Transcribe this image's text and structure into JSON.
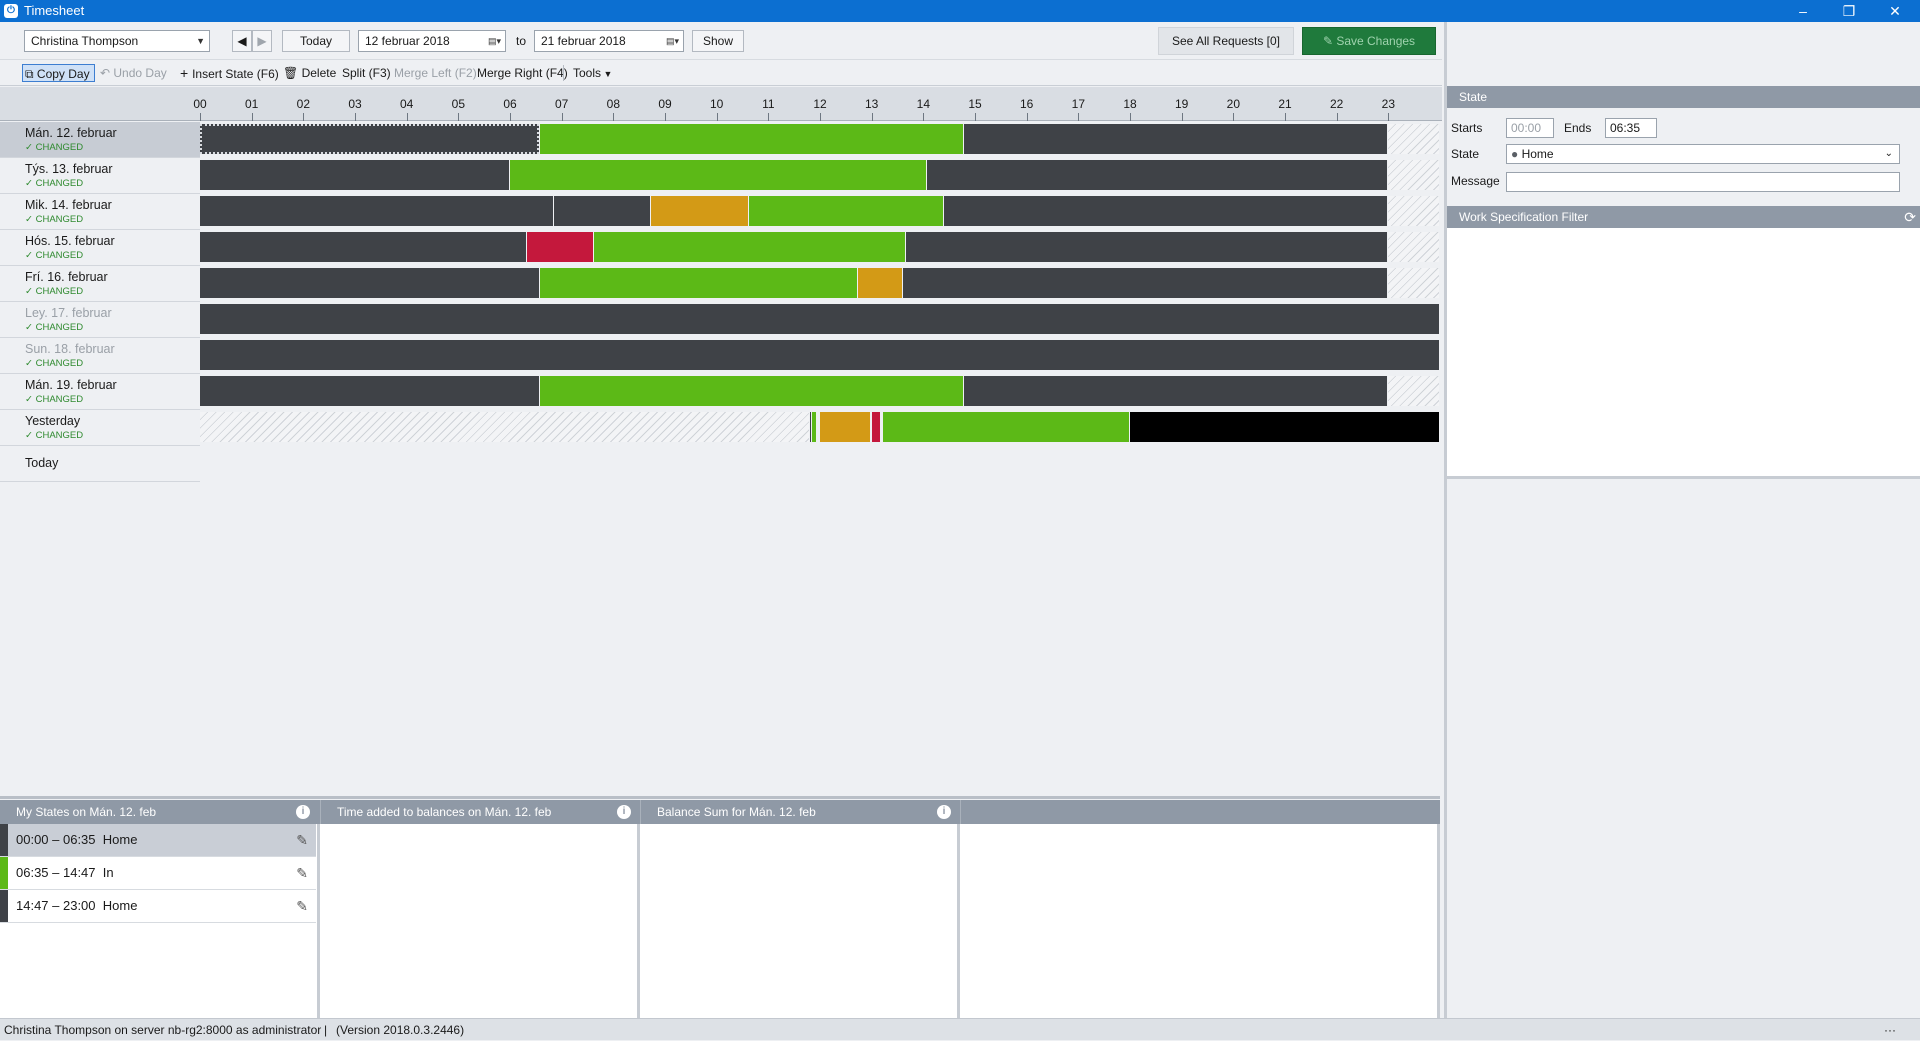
{
  "window": {
    "title": "Timesheet",
    "buttons": {
      "minimize": "–",
      "restore": "❐",
      "close": "✕"
    }
  },
  "toolbar": {
    "user": "Christina Thompson",
    "today_label": "Today",
    "from_date": "12  februar  2018",
    "to_label": "to",
    "to_date": "21  februar  2018",
    "show_label": "Show",
    "see_all_requests": "See All Requests [0]",
    "save_changes": "Save Changes"
  },
  "commands": {
    "copy_day": "Copy Day",
    "undo_day": "Undo Day",
    "insert_state": "Insert State (F6)",
    "delete": "Delete",
    "split": "Split (F3)",
    "merge_left": "Merge Left (F2)",
    "merge_right": "Merge Right (F4)",
    "tools": "Tools"
  },
  "timeline": {
    "hours": [
      "00",
      "01",
      "02",
      "03",
      "04",
      "05",
      "06",
      "07",
      "08",
      "09",
      "10",
      "11",
      "12",
      "13",
      "14",
      "15",
      "16",
      "17",
      "18",
      "19",
      "20",
      "21",
      "22",
      "23"
    ],
    "changed_label": "✓ CHANGED",
    "colors": {
      "home": "#3f4247",
      "in": "#5cb917",
      "orange": "#d39a16",
      "red": "#c4183c",
      "black": "#000000"
    },
    "days": [
      {
        "label": "Mán. 12. februar",
        "changed": true,
        "weekend": false,
        "selected": true,
        "segments": [
          {
            "start": 0,
            "end": 6.58,
            "state": "home",
            "dotted": true
          },
          {
            "start": 6.58,
            "end": 14.78,
            "state": "in"
          },
          {
            "start": 14.78,
            "end": 23.0,
            "state": "home"
          },
          {
            "start": 23.0,
            "end": 24.0,
            "state": "hatch"
          }
        ]
      },
      {
        "label": "Týs. 13. februar",
        "changed": true,
        "weekend": false,
        "selected": false,
        "segments": [
          {
            "start": 0,
            "end": 6.0,
            "state": "home"
          },
          {
            "start": 6.0,
            "end": 14.07,
            "state": "in"
          },
          {
            "start": 14.07,
            "end": 23.0,
            "state": "home"
          },
          {
            "start": 23.0,
            "end": 24.0,
            "state": "hatch"
          }
        ]
      },
      {
        "label": "Mik. 14. februar",
        "changed": true,
        "weekend": false,
        "selected": false,
        "segments": [
          {
            "start": 0,
            "end": 6.85,
            "state": "home"
          },
          {
            "start": 6.85,
            "end": 8.73,
            "state": "home"
          },
          {
            "start": 8.73,
            "end": 10.63,
            "state": "orange"
          },
          {
            "start": 10.63,
            "end": 14.4,
            "state": "in"
          },
          {
            "start": 14.4,
            "end": 23.0,
            "state": "home"
          },
          {
            "start": 23.0,
            "end": 24.0,
            "state": "hatch"
          }
        ]
      },
      {
        "label": "Hós. 15. februar",
        "changed": true,
        "weekend": false,
        "selected": false,
        "segments": [
          {
            "start": 0,
            "end": 6.33,
            "state": "home"
          },
          {
            "start": 6.33,
            "end": 7.63,
            "state": "red"
          },
          {
            "start": 7.63,
            "end": 13.67,
            "state": "in"
          },
          {
            "start": 13.67,
            "end": 23.0,
            "state": "home"
          },
          {
            "start": 23.0,
            "end": 24.0,
            "state": "hatch"
          }
        ]
      },
      {
        "label": "Frí. 16. februar",
        "changed": true,
        "weekend": false,
        "selected": false,
        "segments": [
          {
            "start": 0,
            "end": 6.58,
            "state": "home"
          },
          {
            "start": 6.58,
            "end": 12.73,
            "state": "in"
          },
          {
            "start": 12.73,
            "end": 13.6,
            "state": "orange"
          },
          {
            "start": 13.6,
            "end": 23.0,
            "state": "home"
          },
          {
            "start": 23.0,
            "end": 24.0,
            "state": "hatch"
          }
        ]
      },
      {
        "label": "Ley. 17. februar",
        "changed": true,
        "weekend": true,
        "selected": false,
        "segments": [
          {
            "start": 0,
            "end": 24.0,
            "state": "home"
          }
        ]
      },
      {
        "label": "Sun. 18. februar",
        "changed": true,
        "weekend": true,
        "selected": false,
        "segments": [
          {
            "start": 0,
            "end": 24.0,
            "state": "home"
          }
        ]
      },
      {
        "label": "Mán. 19. februar",
        "changed": true,
        "weekend": false,
        "selected": false,
        "segments": [
          {
            "start": 0,
            "end": 6.58,
            "state": "home"
          },
          {
            "start": 6.58,
            "end": 14.78,
            "state": "in"
          },
          {
            "start": 14.78,
            "end": 23.0,
            "state": "home"
          },
          {
            "start": 23.0,
            "end": 24.0,
            "state": "hatch"
          }
        ]
      },
      {
        "label": "Yesterday",
        "changed": true,
        "weekend": false,
        "selected": false,
        "segments": [
          {
            "start": 0,
            "end": 11.8,
            "state": "hatch"
          },
          {
            "start": 11.8,
            "end": 11.85,
            "state": "home"
          },
          {
            "start": 11.85,
            "end": 11.95,
            "state": "in"
          },
          {
            "start": 12.0,
            "end": 12.98,
            "state": "orange"
          },
          {
            "start": 13.0,
            "end": 13.18,
            "state": "red"
          },
          {
            "start": 13.22,
            "end": 18.0,
            "state": "in"
          },
          {
            "start": 18.0,
            "end": 24.0,
            "state": "black"
          }
        ]
      },
      {
        "label": "Today",
        "changed": false,
        "weekend": false,
        "selected": false,
        "segments": []
      }
    ]
  },
  "state_panel": {
    "title": "State",
    "starts_label": "Starts",
    "starts_value": "00:00",
    "ends_label": "Ends",
    "ends_value": "06:35",
    "state_label": "State",
    "state_value": "Home",
    "message_label": "Message",
    "message_value": ""
  },
  "work_spec": {
    "title": "Work Specification Filter"
  },
  "bottom": {
    "my_states_title": "My States on Mán. 12. feb",
    "time_added_title": "Time added to balances on Mán. 12. feb",
    "balance_sum_title": "Balance Sum for Mán. 12. feb",
    "states": [
      {
        "range": "00:00 – 06:35",
        "name": "Home",
        "state": "home"
      },
      {
        "range": "06:35 – 14:47",
        "name": "In",
        "state": "in"
      },
      {
        "range": "14:47 – 23:00",
        "name": "Home",
        "state": "home"
      }
    ]
  },
  "status": {
    "text": "Christina Thompson on server nb-rg2:8000 as administrator",
    "version": "(Version 2018.0.3.2446)",
    "more": "···"
  }
}
